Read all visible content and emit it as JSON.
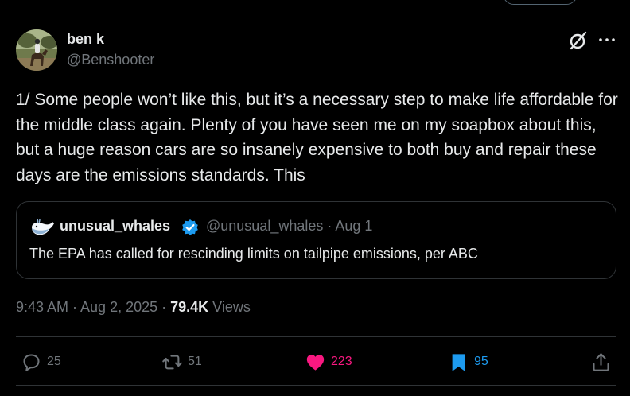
{
  "author": {
    "display_name": "ben k",
    "handle": "@Benshooter",
    "avatar": "avatar-photo-horse-rider"
  },
  "post": {
    "text": "1/ Some people won’t like this, but it’s a necessary step to make life affordable for the middle class again. Plenty of you have seen me on my soapbox about this, but a huge reason cars are so insanely expensive to both buy and repair these days are the emissions standards. This"
  },
  "quote": {
    "display_name": "unusual_whales",
    "handle_date": "@unusual_whales · Aug 1",
    "text": "The EPA has called for rescinding limits on tailpipe emissions, per ABC",
    "avatar": "whale-icon",
    "badge": "verified-badge-icon"
  },
  "meta": {
    "timestamp": "9:43 AM · Aug 2, 2025 · ",
    "views_count": "79.4K",
    "views_label": " Views"
  },
  "actions": {
    "replies": "25",
    "reposts": "51",
    "likes": "223",
    "bookmarks": "95"
  },
  "colors": {
    "background": "#000000",
    "text": "#e7e9ea",
    "muted": "#71767b",
    "like": "#f91880",
    "bookmark": "#1d9bf0",
    "verified": "#1d9bf0",
    "border": "#2f3336"
  }
}
